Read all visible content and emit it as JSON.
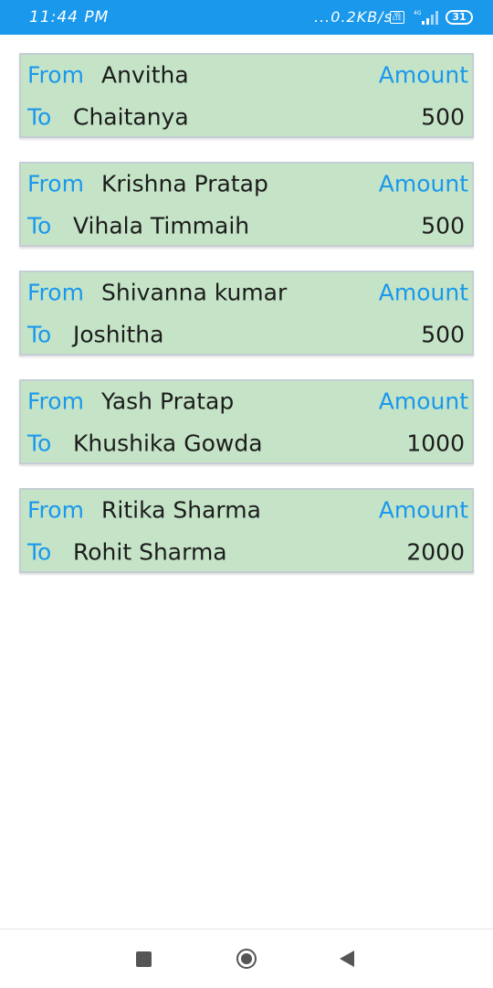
{
  "status_bar": {
    "time": "11:44 PM",
    "speed": "...0.2KB/s",
    "network_badge": "4G",
    "volte_label": "Vo LTE",
    "battery": "31",
    "icons": [
      "volte-icon",
      "signal-icon",
      "battery-icon"
    ]
  },
  "labels": {
    "from": "From",
    "to": "To",
    "amount": "Amount"
  },
  "transactions": [
    {
      "from": "Anvitha",
      "to": "Chaitanya",
      "amount": "500"
    },
    {
      "from": "Krishna Pratap",
      "to": "Vihala Timmaih",
      "amount": "500"
    },
    {
      "from": "Shivanna kumar",
      "to": "Joshitha",
      "amount": "500"
    },
    {
      "from": "Yash Pratap",
      "to": "Khushika Gowda",
      "amount": "1000"
    },
    {
      "from": "Ritika Sharma",
      "to": "Rohit Sharma",
      "amount": "2000"
    }
  ],
  "nav_bar": {
    "icons": [
      "recents-icon",
      "home-icon",
      "back-icon"
    ]
  },
  "colors": {
    "status_bar": "#1a98ec",
    "card_bg": "#c5e4c7",
    "label_blue": "#1a98ec",
    "text_dark": "#1c1c1c"
  }
}
